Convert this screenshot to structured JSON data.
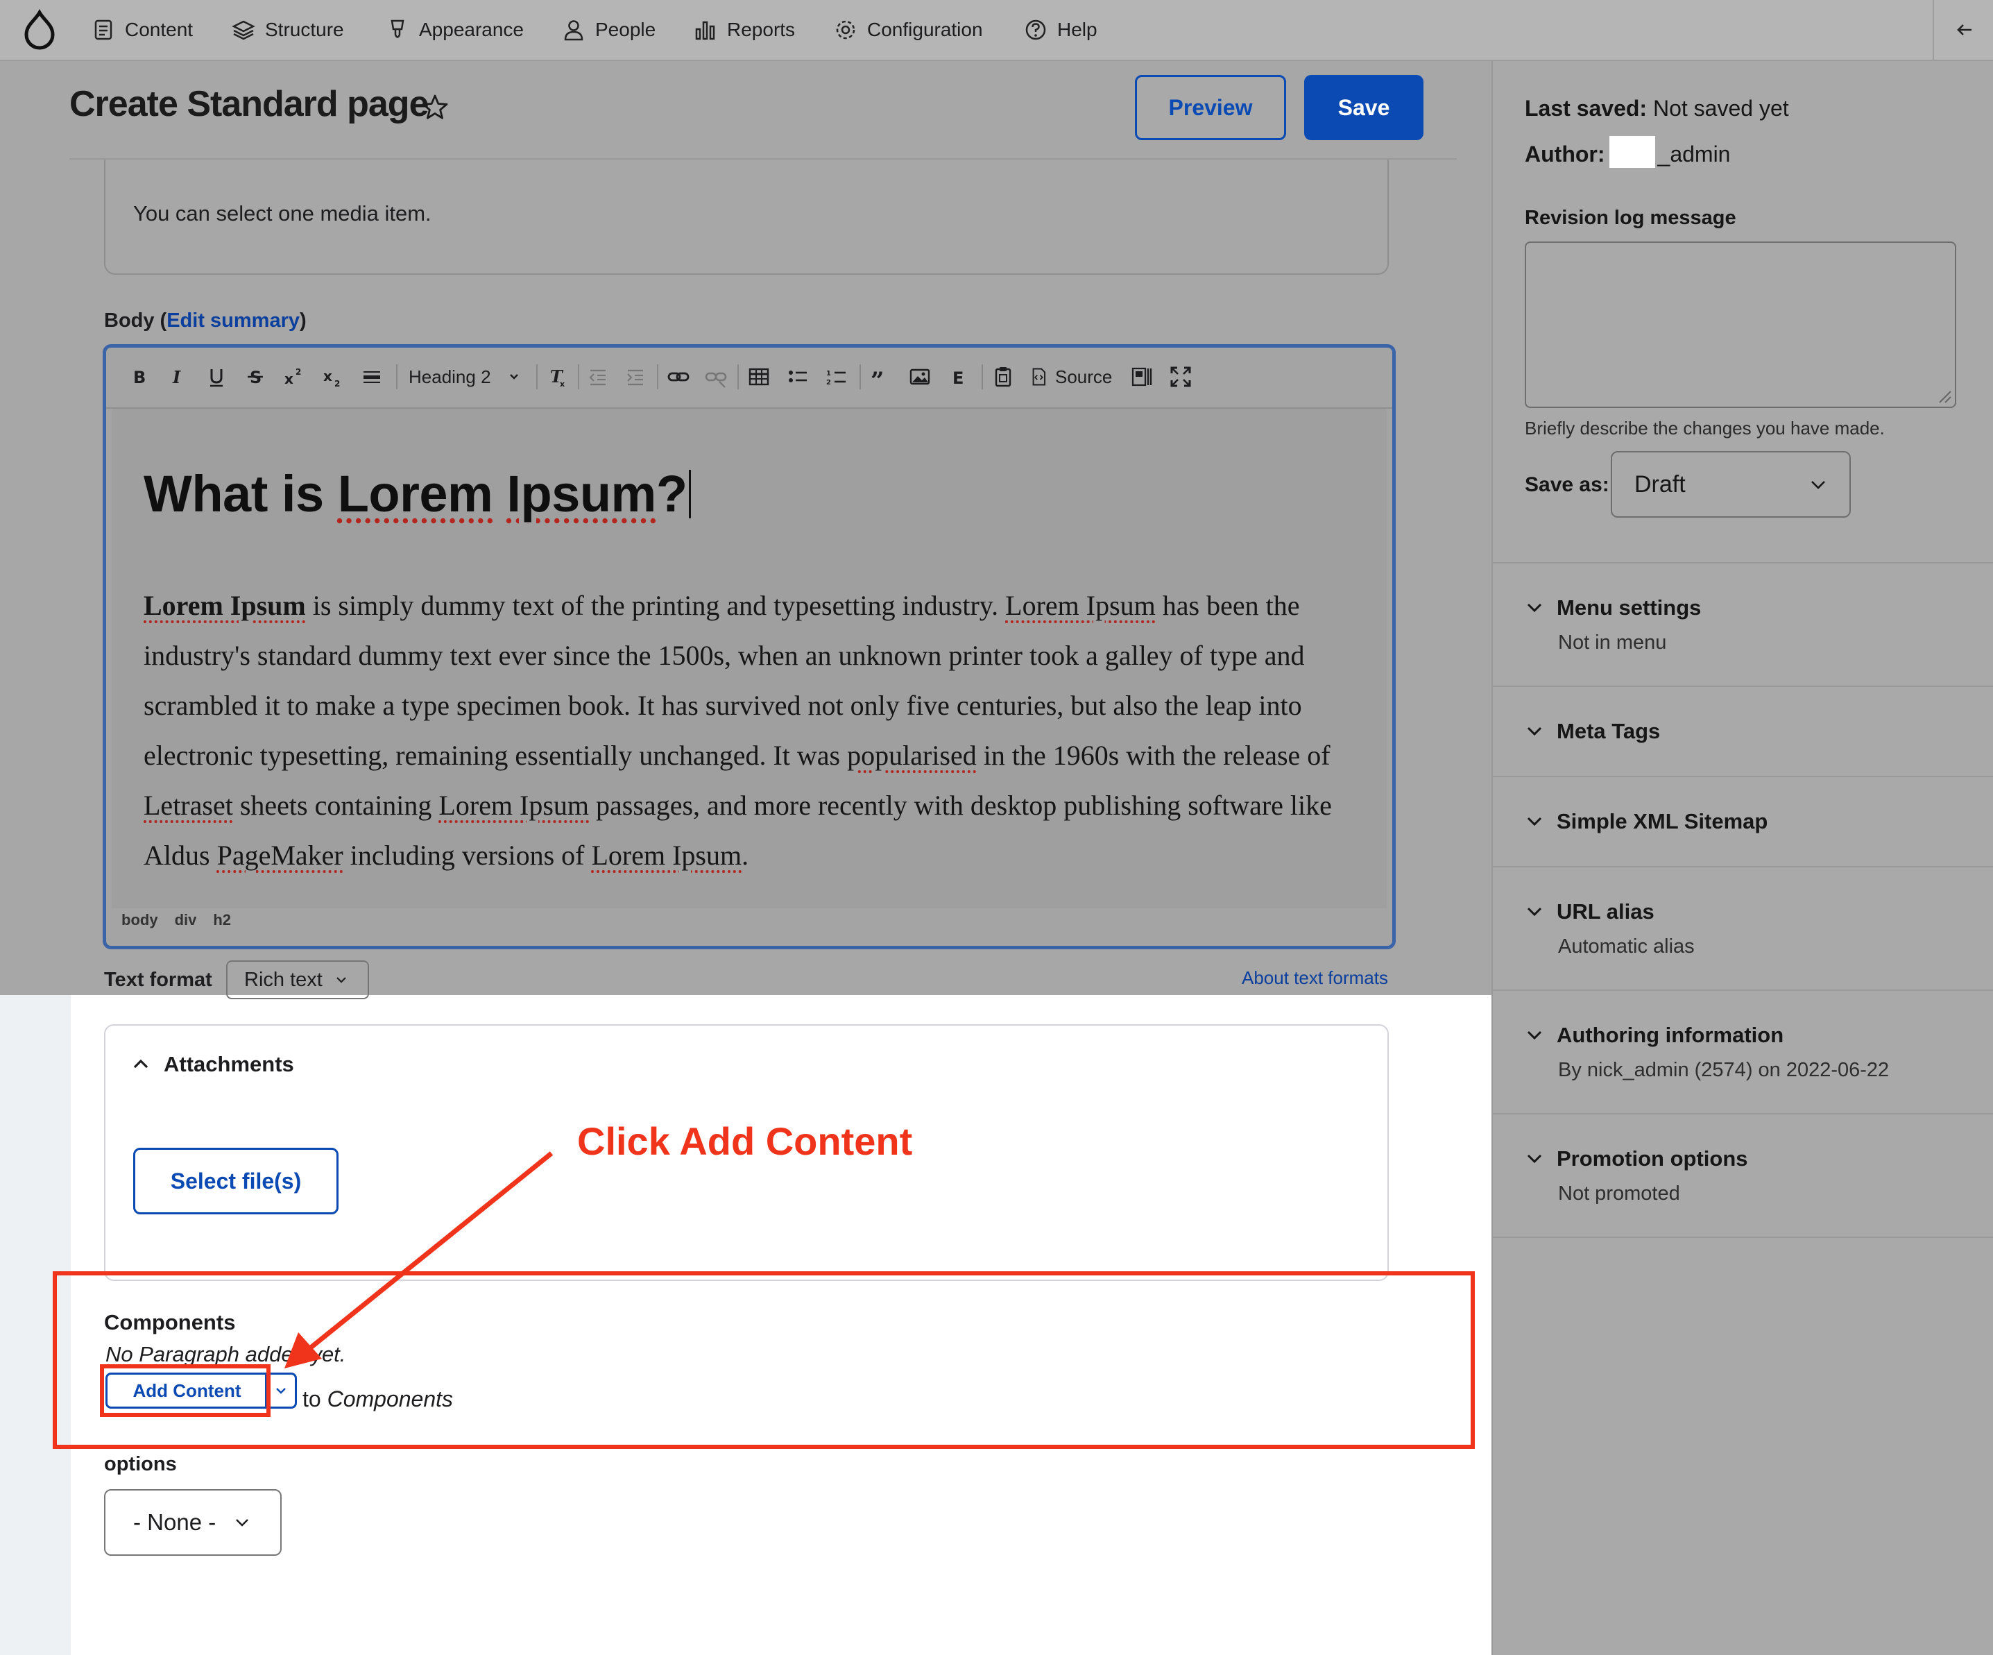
{
  "toolbar": {
    "items": [
      {
        "label": "Content",
        "icon": "document-icon"
      },
      {
        "label": "Structure",
        "icon": "layers-icon"
      },
      {
        "label": "Appearance",
        "icon": "brush-icon"
      },
      {
        "label": "People",
        "icon": "person-icon"
      },
      {
        "label": "Reports",
        "icon": "bar-chart-icon"
      },
      {
        "label": "Configuration",
        "icon": "gear-icon"
      },
      {
        "label": "Help",
        "icon": "help-icon"
      }
    ]
  },
  "header": {
    "title": "Create Standard page",
    "preview_label": "Preview",
    "save_label": "Save"
  },
  "media": {
    "help_text": "You can select one media item."
  },
  "body_field": {
    "label": "Body (",
    "edit_summary": "Edit summary",
    "label_close": ")",
    "heading_select": "Heading 2",
    "source_label": "Source",
    "content_heading_part1": "What is ",
    "content_heading_part2": "Lorem",
    "content_heading_part3": " ",
    "content_heading_part4": "Ipsum",
    "content_heading_part5": "?",
    "paragraph": [
      {
        "t": "Lorem Ipsum",
        "b": true,
        "sq": true
      },
      {
        "t": " is simply dummy text of the printing and typesetting industry. "
      },
      {
        "t": "Lorem Ipsum",
        "sq": true
      },
      {
        "t": " has been the industry's standard dummy text ever since the 1500s, when an unknown printer took a galley of type and scrambled it to make a type specimen book. It has survived not only five centuries, but also the leap into electronic typesetting, remaining essentially unchanged. It was "
      },
      {
        "t": "popularised",
        "sq": true
      },
      {
        "t": " in the 1960s with the release of "
      },
      {
        "t": "Letraset",
        "sq": true
      },
      {
        "t": " sheets containing "
      },
      {
        "t": "Lorem Ipsum",
        "sq": true
      },
      {
        "t": " passages, and more recently with desktop publishing software like Aldus "
      },
      {
        "t": "PageMaker",
        "sq": true
      },
      {
        "t": " including versions of "
      },
      {
        "t": "Lorem Ipsum",
        "sq": true
      },
      {
        "t": "."
      }
    ],
    "path": [
      "body",
      "div",
      "h2"
    ],
    "text_format_label": "Text format",
    "text_format_value": "Rich text",
    "about_formats": "About text formats"
  },
  "attachments": {
    "title": "Attachments",
    "select_files": "Select file(s)"
  },
  "components": {
    "label": "Components",
    "empty_text": "No Paragraph added yet.",
    "add_content": "Add Content",
    "to_text": "to",
    "to_target": "Components"
  },
  "options": {
    "label": "options",
    "value": "- None -"
  },
  "annotation": {
    "text": "Click Add Content",
    "color": "#f0341b"
  },
  "sidebar": {
    "last_saved_label": "Last saved:",
    "last_saved_value": "Not saved yet",
    "author_label": "Author:",
    "author_value": "_admin",
    "revision_label": "Revision log message",
    "revision_help": "Briefly describe the changes you have made.",
    "save_as_label": "Save as:",
    "save_as_value": "Draft",
    "sections": [
      {
        "title": "Menu settings",
        "sub": "Not in menu"
      },
      {
        "title": "Meta Tags",
        "sub": ""
      },
      {
        "title": "Simple XML Sitemap",
        "sub": ""
      },
      {
        "title": "URL alias",
        "sub": "Automatic alias"
      },
      {
        "title": "Authoring information",
        "sub": "By nick_admin (2574) on 2022-06-22"
      },
      {
        "title": "Promotion options",
        "sub": "Not promoted"
      }
    ]
  },
  "colors": {
    "accent": "#0b4ab3",
    "annotation": "#f0341b"
  }
}
